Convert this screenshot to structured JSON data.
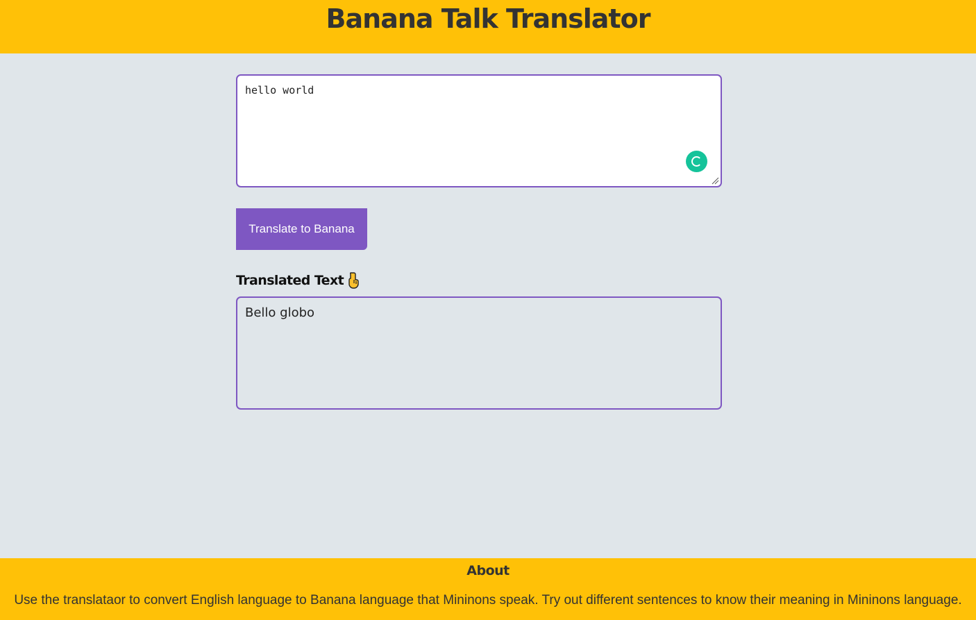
{
  "header": {
    "title": "Banana Talk Translator"
  },
  "input": {
    "value": "hello world"
  },
  "translate_button": {
    "label": "Translate to Banana"
  },
  "output": {
    "label": "Translated Text",
    "value": "Bello globo"
  },
  "footer": {
    "heading": "About",
    "text": "Use the translataor to convert English language to Banana language that Mininons speak. Try out different sentences to know their meaning in Mininons language."
  },
  "icons": {
    "grammarly": "grammarly-icon",
    "pointing": "pointing-down-icon",
    "resize": "resize-handle-icon"
  },
  "colors": {
    "brand_yellow": "#FFC107",
    "accent_purple": "#7E57C2",
    "page_background": "#E0E6EA",
    "grammarly_green": "#15C39A"
  }
}
